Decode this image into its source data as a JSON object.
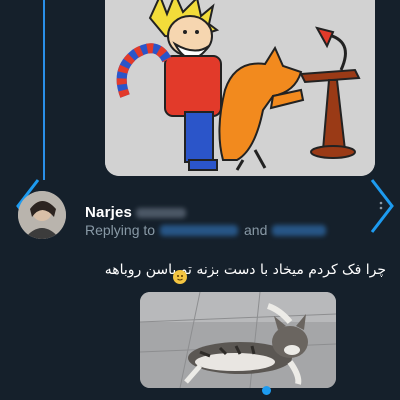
{
  "tweet": {
    "author_name": "Narjes",
    "replying_prefix": "Replying to",
    "replying_joiner": "and",
    "text": "چرا فک کردم میخاد با دست بزنه تو باسن روباهه"
  },
  "icons": {
    "prev": "chevron-left-icon",
    "next": "chevron-right-icon",
    "more": "more-options-icon"
  },
  "colors": {
    "background": "#15202b",
    "accent": "#1d9bf0",
    "secondary_text": "#8899a6"
  }
}
